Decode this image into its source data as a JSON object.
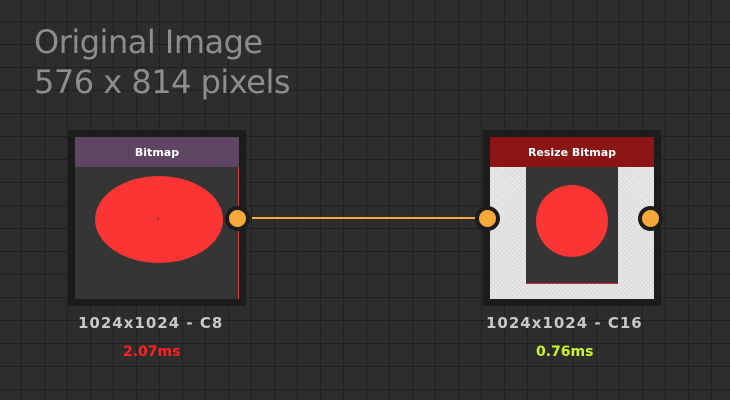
{
  "canvas_info": {
    "title": "Original Image",
    "subtitle": "576 x 814 pixels"
  },
  "nodes": [
    {
      "title": "Bitmap",
      "header_color": "#5e4663",
      "info": "1024x1024 - C8",
      "timing": "2.07ms",
      "timing_color": "#ff2020"
    },
    {
      "title": "Resize Bitmap",
      "header_color": "#8b1414",
      "info": "1024x1024 - C16",
      "timing": "0.76ms",
      "timing_color": "#c9f52a"
    }
  ],
  "colors": {
    "port": "#f7a83a",
    "connection": "#f5a93e",
    "preview_fill": "#fb3434"
  }
}
